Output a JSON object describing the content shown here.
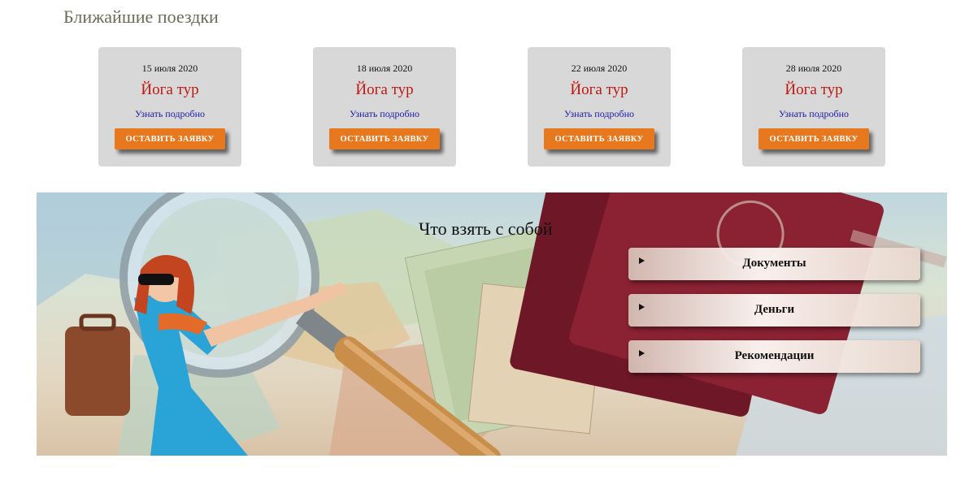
{
  "upcoming": {
    "title": "Ближайшие поездки",
    "trips": [
      {
        "date": "15 июля 2020",
        "name": "Йога тур",
        "more_link": "Узнать подробно",
        "button": "ОСТАВИТЬ ЗАЯВКУ"
      },
      {
        "date": "18 июля 2020",
        "name": "Йога тур",
        "more_link": "Узнать подробно",
        "button": "ОСТАВИТЬ ЗАЯВКУ"
      },
      {
        "date": "22 июля 2020",
        "name": "Йога тур",
        "more_link": "Узнать подробно",
        "button": "ОСТАВИТЬ ЗАЯВКУ"
      },
      {
        "date": "28 июля 2020",
        "name": "Йога тур",
        "more_link": "Узнать подробно",
        "button": "ОСТАВИТЬ ЗАЯВКУ"
      }
    ]
  },
  "packing": {
    "title": "Что взять с собой",
    "items": [
      {
        "label": "Документы",
        "expanded": false
      },
      {
        "label": "Деньги",
        "expanded": false
      },
      {
        "label": "Рекомендации",
        "expanded": false
      }
    ]
  },
  "colors": {
    "card_bg": "#d8d8d8",
    "trip_name": "#c0170f",
    "link": "#1a1aa6",
    "button_bg": "#e8781e",
    "heading": "#6b6b58",
    "passport": "#7e1d2c"
  }
}
